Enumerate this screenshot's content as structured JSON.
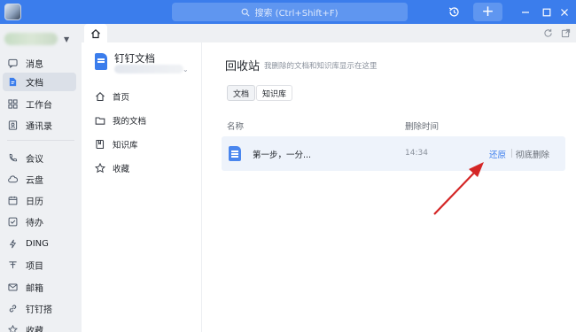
{
  "titlebar": {
    "search_placeholder": "搜索 (Ctrl+Shift+F)",
    "accent": "#3b7dec"
  },
  "leftnav": {
    "items": [
      {
        "label": "消息",
        "icon": "message-icon"
      },
      {
        "label": "文档",
        "icon": "document-icon",
        "active": true
      },
      {
        "label": "工作台",
        "icon": "grid-icon"
      },
      {
        "label": "通讯录",
        "icon": "contacts-icon"
      },
      {
        "label": "会议",
        "icon": "phone-icon"
      },
      {
        "label": "云盘",
        "icon": "cloud-icon"
      },
      {
        "label": "日历",
        "icon": "calendar-icon"
      },
      {
        "label": "待办",
        "icon": "checkbox-icon"
      },
      {
        "label": "DING",
        "icon": "lightning-icon"
      },
      {
        "label": "项目",
        "icon": "project-icon"
      },
      {
        "label": "邮箱",
        "icon": "mail-icon"
      },
      {
        "label": "钉钉搭",
        "icon": "link-icon"
      },
      {
        "label": "收藏",
        "icon": "star-icon"
      }
    ]
  },
  "docsidebar": {
    "title": "钉钉文档",
    "items": [
      {
        "label": "首页",
        "icon": "home-icon"
      },
      {
        "label": "我的文档",
        "icon": "folder-icon"
      },
      {
        "label": "知识库",
        "icon": "book-icon"
      },
      {
        "label": "收藏",
        "icon": "star-icon"
      }
    ]
  },
  "main": {
    "title": "回收站",
    "hint": "我删除的文档和知识库显示在这里",
    "filters": [
      "文档",
      "知识库"
    ],
    "columns": {
      "name": "名称",
      "deleted_time": "删除时间"
    },
    "rows": [
      {
        "name": "第一步，一分...",
        "time": "14:34",
        "restore": "还原",
        "delete": "彻底删除"
      }
    ]
  }
}
